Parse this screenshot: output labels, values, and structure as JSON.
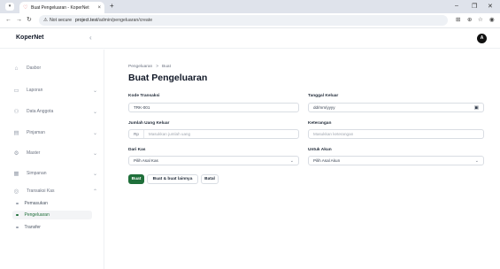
{
  "browser": {
    "tab_title": "Buat Pengeluaran - KoperNet",
    "tab_close": "×",
    "new_tab": "+",
    "security_label": "Not secure",
    "url_host": "project.test",
    "url_path": "/admin/pengeluaran/create"
  },
  "app": {
    "brand": "KoperNet",
    "user_initial": "A"
  },
  "sidebar": {
    "items": [
      {
        "label": "Dasbor",
        "icon": "home-icon",
        "has_chevron": false
      },
      {
        "label": "Laporan",
        "icon": "document-icon",
        "has_chevron": true
      },
      {
        "label": "Data Anggota",
        "icon": "users-icon",
        "has_chevron": true
      },
      {
        "label": "Pinjaman",
        "icon": "loan-icon",
        "has_chevron": true
      },
      {
        "label": "Master",
        "icon": "gear-icon",
        "has_chevron": true
      },
      {
        "label": "Simpanan",
        "icon": "savings-icon",
        "has_chevron": true
      },
      {
        "label": "Transaksi Kas",
        "icon": "cash-icon",
        "has_chevron": true
      }
    ],
    "subitems": [
      {
        "label": "Pemasukan",
        "active": false
      },
      {
        "label": "Pengeluaran",
        "active": true
      },
      {
        "label": "Transfer",
        "active": false
      }
    ]
  },
  "breadcrumb": {
    "parent": "Pengeluaran",
    "separator": ">",
    "current": "Buat"
  },
  "page_title": "Buat Pengeluaran",
  "form": {
    "kode_transaksi": {
      "label": "Kode Transaksi",
      "value": "TRK-001"
    },
    "tanggal_keluar": {
      "label": "Tanggal Keluar",
      "value": "dd/mm/yyyy"
    },
    "jumlah_uang": {
      "label": "Jumlah Uang Keluar",
      "prefix": "Rp",
      "placeholder": "Masukkan jumlah uang"
    },
    "keterangan": {
      "label": "Keterangan",
      "placeholder": "Masukkan keterangan"
    },
    "dari_kas": {
      "label": "Dari Kas",
      "value": "Pilih Asal Kas"
    },
    "untuk_akun": {
      "label": "Untuk Akun",
      "value": "Pilih Asal Akun"
    }
  },
  "buttons": {
    "create": "Buat",
    "create_another": "Buat & buat lainnya",
    "cancel": "Batal"
  },
  "colors": {
    "primary": "#1f6f3a",
    "accent_favicon": "#e26a6a"
  }
}
